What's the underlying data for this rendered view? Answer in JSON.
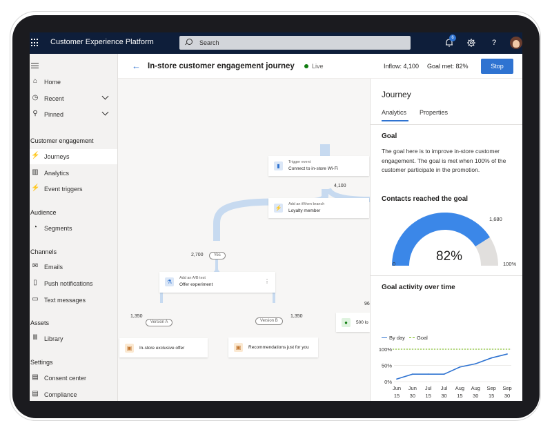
{
  "app": {
    "title": "Customer Experience Platform"
  },
  "topbar": {
    "search_placeholder": "Search",
    "notification_count": "6",
    "icons": [
      "waffle-icon",
      "bell-icon",
      "gear-icon",
      "help-icon",
      "avatar"
    ]
  },
  "sidebar": {
    "top_items": [
      {
        "label": "Home",
        "icon": "home-icon"
      },
      {
        "label": "Recent",
        "icon": "clock-icon",
        "expandable": true
      },
      {
        "label": "Pinned",
        "icon": "pin-icon",
        "expandable": true
      }
    ],
    "groups": [
      {
        "heading": "Customer engagement",
        "items": [
          {
            "label": "Journeys",
            "icon": "journey-icon",
            "active": true
          },
          {
            "label": "Analytics",
            "icon": "analytics-icon"
          },
          {
            "label": "Event triggers",
            "icon": "trigger-icon"
          }
        ]
      },
      {
        "heading": "Audience",
        "items": [
          {
            "label": "Segments",
            "icon": "segments-icon"
          }
        ]
      },
      {
        "heading": "Channels",
        "items": [
          {
            "label": "Emails",
            "icon": "email-icon"
          },
          {
            "label": "Push notifications",
            "icon": "phone-icon"
          },
          {
            "label": "Text messages",
            "icon": "message-icon"
          }
        ]
      },
      {
        "heading": "Assets",
        "items": [
          {
            "label": "Library",
            "icon": "library-icon"
          }
        ]
      },
      {
        "heading": "Settings",
        "items": [
          {
            "label": "Consent center",
            "icon": "consent-icon"
          },
          {
            "label": "Compliance",
            "icon": "compliance-icon"
          }
        ]
      }
    ]
  },
  "header": {
    "title": "In-store customer engagement journey",
    "status": "Live",
    "inflow": "Inflow: 4,100",
    "goal_met": "Goal met: 82%",
    "stop_label": "Stop"
  },
  "canvas": {
    "trigger": {
      "sub": "Trigger event",
      "main": "Connect to in-store Wi-Fi"
    },
    "branch": {
      "sub": "Add an if/then branch",
      "main": "Loyalty member"
    },
    "ab_test": {
      "sub": "Add an A/B test",
      "main": "Offer experiment"
    },
    "offer_a": "In-store exclusive offer",
    "offer_b": "Recommendations just for you",
    "partial_tile": "500 lo",
    "partial_number": "96",
    "count_total": "4,100",
    "count_yes": "2,700",
    "yes_pill": "Yes",
    "count_a": "1,350",
    "count_b": "1,350",
    "version_a": "Version A",
    "version_b": "Version B"
  },
  "panel": {
    "title": "Journey",
    "tabs": [
      "Analytics",
      "Properties"
    ],
    "active_tab": "Analytics",
    "goal_heading": "Goal",
    "goal_text": "The goal here is to improve in-store customer engagement. The goal is met when 100% of the customer participate in the promotion.",
    "contacts_heading": "Contacts reached the goal",
    "gauge": {
      "value_label": "82%",
      "fraction": 0.82,
      "min_label": "0",
      "max_label": "100%",
      "count_label": "1,680"
    },
    "activity_heading": "Goal activity over time",
    "legend": {
      "by_day": "By day",
      "goal": "Goal"
    }
  },
  "colors": {
    "accent": "#2f73d1",
    "topbar": "#0e1e3a",
    "flow": "#c7daf0",
    "goal_line": "#6bb700",
    "live": "#107c10"
  },
  "chart_data": {
    "type": "line",
    "title": "Goal activity over time",
    "categories": [
      "Jun 15",
      "Jun 30",
      "Jul 15",
      "Jul 30",
      "Aug 15",
      "Aug 30",
      "Sep 15",
      "Sep 30"
    ],
    "series": [
      {
        "name": "By day",
        "values": [
          8,
          23,
          23,
          23,
          45,
          55,
          73,
          85
        ]
      },
      {
        "name": "Goal",
        "values": [
          100,
          100,
          100,
          100,
          100,
          100,
          100,
          100
        ]
      }
    ],
    "y_ticks": [
      "0%",
      "50%",
      "100%"
    ],
    "ylim": [
      0,
      100
    ],
    "grid": true
  }
}
